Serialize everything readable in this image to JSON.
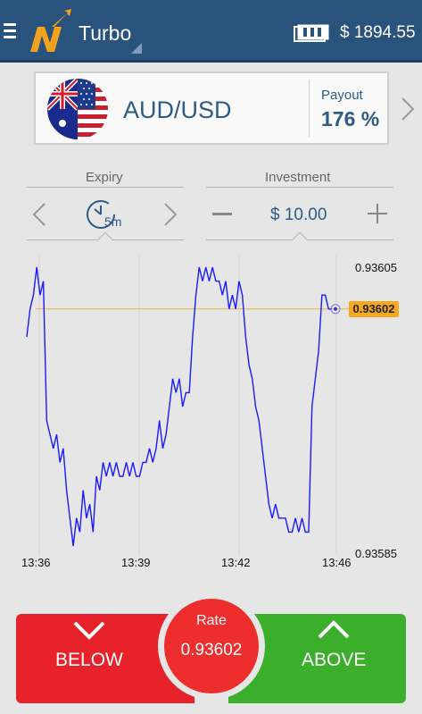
{
  "header": {
    "title": "Turbo",
    "balance": "$ 1894.55",
    "icons": [
      "menu-icon",
      "logo-icon",
      "wallet-icon"
    ]
  },
  "asset": {
    "name": "AUD/USD",
    "payout_label": "Payout",
    "payout_value": "176 %"
  },
  "expiry": {
    "label": "Expiry",
    "value": "5m"
  },
  "investment": {
    "label": "Investment",
    "value": "$ 10.00"
  },
  "chart_data": {
    "type": "line",
    "y_max_label": "0.93605",
    "y_min_label": "0.93585",
    "current_price_label": "0.93602",
    "ylim": [
      0.93585,
      0.93605
    ],
    "x_tick_labels": [
      "13:36",
      "13:39",
      "13:42",
      "13:46"
    ],
    "series": [
      {
        "color": "#1a1aff",
        "points": [
          [
            0,
            0.936
          ],
          [
            0.4,
            0.93602
          ],
          [
            0.8,
            0.93603
          ],
          [
            1.2,
            0.93605
          ],
          [
            1.6,
            0.93603
          ],
          [
            2.0,
            0.93604
          ],
          [
            2.4,
            0.93594
          ],
          [
            2.8,
            0.93593
          ],
          [
            3.2,
            0.93592
          ],
          [
            3.6,
            0.93593
          ],
          [
            4.0,
            0.93591
          ],
          [
            4.4,
            0.93592
          ],
          [
            4.8,
            0.93589
          ],
          [
            5.2,
            0.93587
          ],
          [
            5.6,
            0.93585
          ],
          [
            6.0,
            0.93587
          ],
          [
            6.4,
            0.93586
          ],
          [
            6.8,
            0.93589
          ],
          [
            7.2,
            0.93587
          ],
          [
            7.6,
            0.93588
          ],
          [
            8.0,
            0.93586
          ],
          [
            8.4,
            0.9359
          ],
          [
            8.8,
            0.93589
          ],
          [
            9.2,
            0.93591
          ],
          [
            9.6,
            0.9359
          ],
          [
            10.0,
            0.93591
          ],
          [
            10.4,
            0.9359
          ],
          [
            10.8,
            0.93591
          ],
          [
            11.2,
            0.9359
          ],
          [
            11.6,
            0.9359
          ],
          [
            12.0,
            0.93591
          ],
          [
            12.4,
            0.9359
          ],
          [
            12.8,
            0.93591
          ],
          [
            13.2,
            0.9359
          ],
          [
            13.6,
            0.9359
          ],
          [
            14.0,
            0.93591
          ],
          [
            14.4,
            0.93591
          ],
          [
            14.8,
            0.93592
          ],
          [
            15.2,
            0.93591
          ],
          [
            15.6,
            0.93592
          ],
          [
            16.0,
            0.93594
          ],
          [
            16.4,
            0.93592
          ],
          [
            16.8,
            0.93593
          ],
          [
            17.2,
            0.93595
          ],
          [
            17.6,
            0.93597
          ],
          [
            18.0,
            0.93596
          ],
          [
            18.4,
            0.93597
          ],
          [
            18.8,
            0.93595
          ],
          [
            19.2,
            0.93596
          ],
          [
            19.6,
            0.93596
          ],
          [
            20.0,
            0.936
          ],
          [
            20.4,
            0.93603
          ],
          [
            20.8,
            0.93605
          ],
          [
            21.2,
            0.93604
          ],
          [
            21.6,
            0.93605
          ],
          [
            22.0,
            0.93604
          ],
          [
            22.4,
            0.93605
          ],
          [
            22.8,
            0.93604
          ],
          [
            23.2,
            0.93604
          ],
          [
            23.6,
            0.93603
          ],
          [
            24.0,
            0.93604
          ],
          [
            24.4,
            0.93602
          ],
          [
            24.8,
            0.93603
          ],
          [
            25.2,
            0.93602
          ],
          [
            25.6,
            0.93604
          ],
          [
            26.0,
            0.93603
          ],
          [
            26.4,
            0.936
          ],
          [
            26.8,
            0.93598
          ],
          [
            27.2,
            0.93597
          ],
          [
            27.6,
            0.93595
          ],
          [
            28.0,
            0.93594
          ],
          [
            28.4,
            0.93592
          ],
          [
            28.8,
            0.9359
          ],
          [
            29.2,
            0.93588
          ],
          [
            29.6,
            0.93587
          ],
          [
            30.0,
            0.93588
          ],
          [
            30.4,
            0.93587
          ],
          [
            30.8,
            0.93587
          ],
          [
            31.2,
            0.93587
          ],
          [
            31.6,
            0.93586
          ],
          [
            32.0,
            0.93586
          ],
          [
            32.4,
            0.93587
          ],
          [
            32.8,
            0.93586
          ],
          [
            33.2,
            0.93587
          ],
          [
            33.6,
            0.93586
          ],
          [
            34.0,
            0.93586
          ],
          [
            34.4,
            0.93595
          ],
          [
            34.8,
            0.93597
          ],
          [
            35.2,
            0.93599
          ],
          [
            35.6,
            0.93603
          ],
          [
            36.0,
            0.93603
          ],
          [
            36.4,
            0.93602
          ],
          [
            36.8,
            0.93602
          ]
        ]
      }
    ],
    "reference_line": {
      "value": 0.93602,
      "color": "#e8b230"
    }
  },
  "actions": {
    "below_label": "BELOW",
    "above_label": "ABOVE",
    "rate_label": "Rate",
    "rate_value": "0.93602"
  }
}
